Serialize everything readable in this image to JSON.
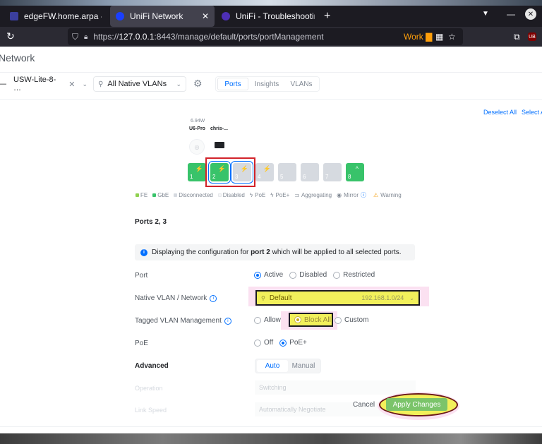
{
  "browser": {
    "tabs": [
      {
        "title": "edgeFW.home.arpa - System",
        "favicon_color": "#3b3f9e"
      },
      {
        "title": "UniFi Network",
        "favicon_color": "#1a3fff"
      },
      {
        "title": "UniFi - Troubleshooting U",
        "favicon_color": "#4d2fb5"
      }
    ],
    "new_tab": "+",
    "url_prefix": "https://",
    "url_host": "127.0.0.1",
    "url_rest": ":8443/manage/default/ports/portManagement",
    "container_label": "Work",
    "ublock_label": "UB"
  },
  "page": {
    "title": "Network",
    "device_select": {
      "dash": "—",
      "value": "USW-Lite-8- …",
      "clear": "✕"
    },
    "vlan_filter": {
      "value": "All Native VLANs"
    },
    "view_tabs": [
      "Ports",
      "Insights",
      "VLANs"
    ],
    "deselect_all": "Deselect All",
    "select_all": "Select All",
    "connected": {
      "watts": "6.94W",
      "device1": "U6-Pro",
      "device2": "chris-..."
    },
    "ports": [
      {
        "num": "1",
        "state": "green",
        "glyph": "⚡"
      },
      {
        "num": "2",
        "state": "green",
        "glyph": "⚡"
      },
      {
        "num": "3",
        "state": "grey",
        "glyph": "⚡"
      },
      {
        "num": "4",
        "state": "grey",
        "glyph": "⚡"
      },
      {
        "num": "5",
        "state": "grey",
        "glyph": ""
      },
      {
        "num": "6",
        "state": "grey",
        "glyph": ""
      },
      {
        "num": "7",
        "state": "grey",
        "glyph": ""
      },
      {
        "num": "8",
        "state": "green",
        "glyph": "^"
      }
    ],
    "legend": {
      "fe": "FE",
      "gbe": "GbE",
      "disconnected": "Disconnected",
      "disabled": "Disabled",
      "poe": "PoE",
      "poe_plus": "PoE+",
      "aggregating": "Aggregating",
      "mirror": "Mirror",
      "warning": "Warning"
    },
    "ports_heading": "Ports 2, 3",
    "info": {
      "before": "Displaying the configuration for ",
      "bold": "port 2",
      "after": " which will be applied to all selected ports."
    },
    "form": {
      "port_label": "Port",
      "port_options": [
        "Active",
        "Disabled",
        "Restricted"
      ],
      "native_label": "Native VLAN / Network",
      "native_value": "Default",
      "native_ip": "192.168.1.0/24",
      "tagged_label": "Tagged VLAN Management",
      "tagged_options": [
        "Allow All",
        "Block All",
        "Custom"
      ],
      "poe_label": "PoE",
      "poe_options": [
        "Off",
        "PoE+"
      ],
      "advanced_label": "Advanced",
      "advanced_tabs": [
        "Auto",
        "Manual"
      ],
      "operation_label": "Operation",
      "operation_value": "Switching",
      "link_speed_label": "Link Speed",
      "link_speed_value": "Automatically Negotiate"
    },
    "cancel": "Cancel",
    "apply": "Apply Changes"
  },
  "colors": {
    "accent": "#006fff",
    "port_green": "#38c36a",
    "port_grey": "#d6dae0",
    "highlight_yellow": "#f2f05b",
    "highlight_pink": "#fbe1f1",
    "selection_red": "#d2232a"
  }
}
